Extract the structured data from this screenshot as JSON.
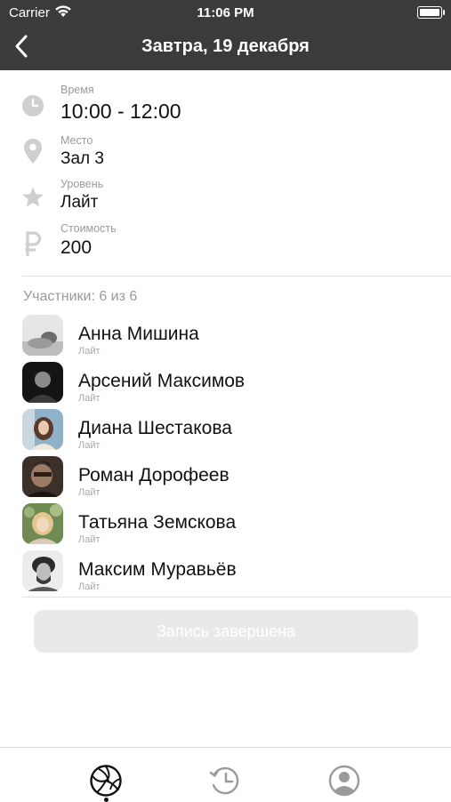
{
  "status_bar": {
    "carrier": "Carrier",
    "time": "11:06 PM"
  },
  "nav": {
    "title": "Завтра, 19 декабря"
  },
  "details": [
    {
      "label": "Время",
      "value": "10:00 - 12:00",
      "icon": "clock-icon"
    },
    {
      "label": "Место",
      "value": "Зал 3",
      "icon": "location-pin-icon"
    },
    {
      "label": "Уровень",
      "value": "Лайт",
      "icon": "star-icon"
    },
    {
      "label": "Стоимость",
      "value": "200",
      "icon": "ruble-icon"
    }
  ],
  "participants": {
    "title": "Участники: 6 из 6",
    "list": [
      {
        "name": "Анна Мишина",
        "level": "Лайт"
      },
      {
        "name": "Арсений Максимов",
        "level": "Лайт"
      },
      {
        "name": "Диана Шестакова",
        "level": "Лайт"
      },
      {
        "name": "Роман Дорофеев",
        "level": "Лайт"
      },
      {
        "name": "Татьяна Земскова",
        "level": "Лайт"
      },
      {
        "name": "Максим Муравьёв",
        "level": "Лайт"
      }
    ]
  },
  "action_button": {
    "label": "Запись завершена",
    "enabled": false
  },
  "tabbar": {
    "tabs": [
      {
        "icon": "volleyball-icon",
        "active": true
      },
      {
        "icon": "history-clock-icon",
        "active": false
      },
      {
        "icon": "profile-icon",
        "active": false
      }
    ]
  },
  "colors": {
    "nav_bar": "#3b3b3b",
    "muted_text": "#9a9a9a",
    "icon_gray": "#cfcfcf",
    "disabled_button": "#e9e9e9"
  }
}
